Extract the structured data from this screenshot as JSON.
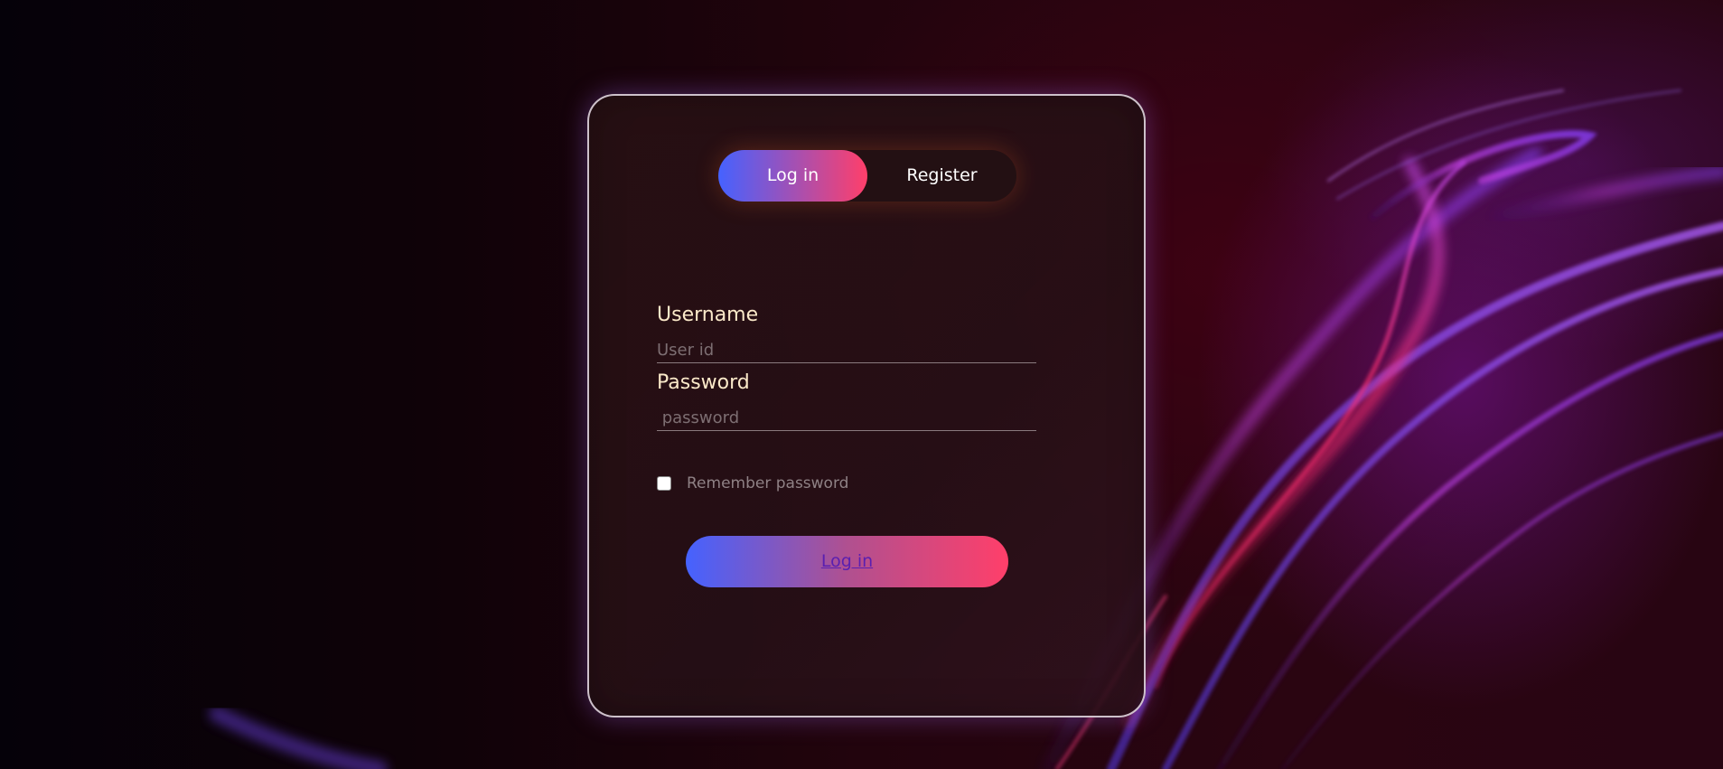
{
  "colors": {
    "accent_start": "#4562ff",
    "accent_end": "#ff3f6a",
    "label": "#fbe9c9",
    "card_border": "#ebe1eb"
  },
  "tabs": {
    "login_label": "Log in",
    "register_label": "Register",
    "active": "login"
  },
  "form": {
    "username_label": "Username",
    "username_placeholder": "User id",
    "username_value": "",
    "password_label": "Password",
    "password_placeholder": " password",
    "password_value": "",
    "remember_label": "Remember password",
    "remember_checked": false,
    "submit_label": "Log in"
  }
}
